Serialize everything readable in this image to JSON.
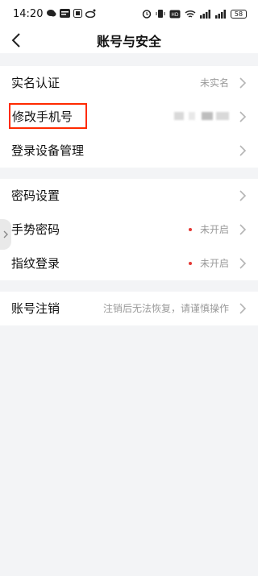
{
  "status_bar": {
    "time": "14:20",
    "battery": "58"
  },
  "header": {
    "title": "账号与安全"
  },
  "groups": [
    {
      "items": [
        {
          "label": "实名认证",
          "value": "未实名"
        },
        {
          "label": "修改手机号",
          "value": ""
        },
        {
          "label": "登录设备管理",
          "value": ""
        }
      ]
    },
    {
      "items": [
        {
          "label": "密码设置",
          "value": ""
        },
        {
          "label": "手势密码",
          "value": "未开启"
        },
        {
          "label": "指纹登录",
          "value": "未开启"
        }
      ]
    },
    {
      "items": [
        {
          "label": "账号注销",
          "value": "注销后无法恢复，请谨慎操作"
        }
      ]
    }
  ],
  "colors": {
    "background": "#f3f4f6",
    "highlight": "#ff2a00",
    "status_dot": "#e53935"
  }
}
